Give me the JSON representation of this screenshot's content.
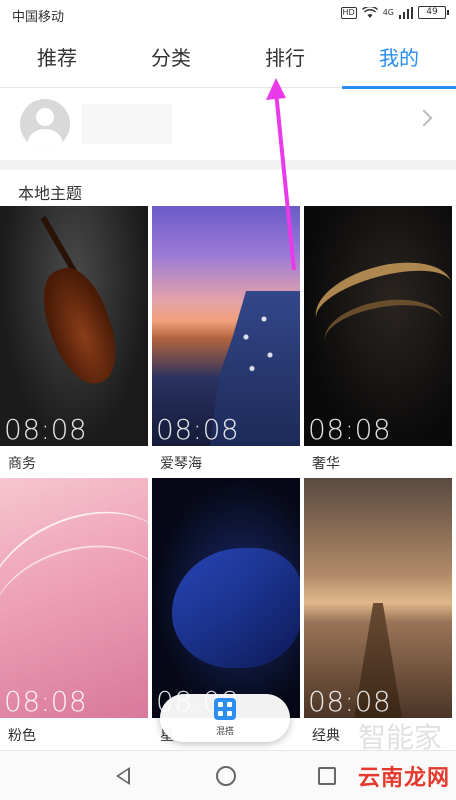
{
  "status_bar": {
    "carrier": "中国移动",
    "hd": "HD",
    "network": "4G",
    "battery": "49"
  },
  "tabs": [
    {
      "label": "推荐",
      "active": false
    },
    {
      "label": "分类",
      "active": false
    },
    {
      "label": "排行",
      "active": false
    },
    {
      "label": "我的",
      "active": true
    }
  ],
  "profile": {
    "avatar_icon": "default-avatar-icon",
    "chevron_icon": "chevron-right-icon"
  },
  "section": {
    "title": "本地主题"
  },
  "themes": [
    {
      "time": "08:08",
      "label": "商务"
    },
    {
      "time": "08:08",
      "label": "爱琴海"
    },
    {
      "time": "08:08",
      "label": "奢华"
    },
    {
      "time": "08:08",
      "label": "粉色"
    },
    {
      "time": "08:08",
      "label": "星"
    },
    {
      "time": "08:08",
      "label": "经典"
    }
  ],
  "floating_button": {
    "label": "混搭",
    "icon": "grid-icon"
  },
  "nav_bar": {
    "back_icon": "back-triangle-icon",
    "home_icon": "home-circle-icon",
    "recent_icon": "recent-square-icon"
  },
  "watermark": {
    "text": "云南龙网",
    "faint_text": "智能家"
  },
  "colors": {
    "accent": "#2b8ef0",
    "annotation_arrow": "#e83ae8",
    "watermark": "#e43a2e"
  }
}
